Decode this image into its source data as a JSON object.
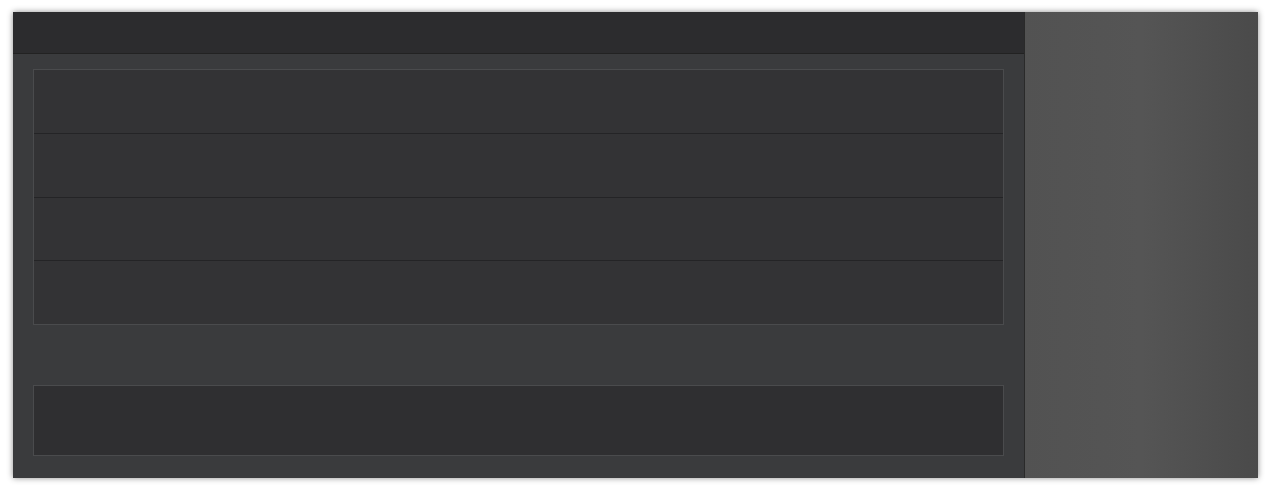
{
  "list": {
    "rows": [
      {
        "kind": "row"
      },
      {
        "kind": "row"
      },
      {
        "kind": "row"
      },
      {
        "kind": "row"
      }
    ]
  },
  "bottom_panel": {
    "kind": "panel"
  }
}
